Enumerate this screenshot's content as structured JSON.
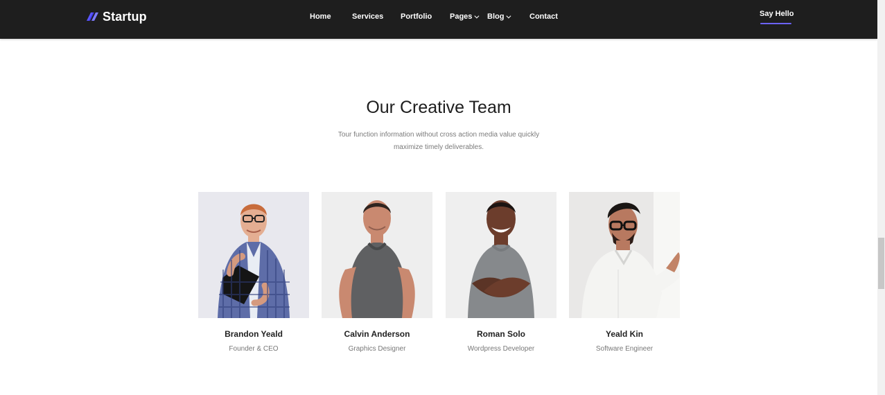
{
  "navbar": {
    "brand_name": "Startup",
    "brand_icon": "startup-logo-icon",
    "brand_accent": "#6c63ff",
    "items": [
      {
        "label": "Home",
        "has_dropdown": false
      },
      {
        "label": "Services",
        "has_dropdown": false
      },
      {
        "label": "Portfolio",
        "has_dropdown": false
      },
      {
        "label": "Pages",
        "has_dropdown": true,
        "dropdown_icon": "chevron-down-icon"
      },
      {
        "label": "Blog",
        "has_dropdown": true,
        "dropdown_icon": "chevron-down-icon"
      },
      {
        "label": "Contact",
        "has_dropdown": false
      }
    ],
    "cta_label": "Say Hello"
  },
  "team_section": {
    "title": "Our Creative Team",
    "subtitle": "Tour function information without cross action media value quickly maximize timely deliverables.",
    "members": [
      {
        "name": "Brandon Yeald",
        "role": "Founder & CEO",
        "photo_description": "man with glasses in plaid shirt holding tablet"
      },
      {
        "name": "Calvin Anderson",
        "role": "Graphics Designer",
        "photo_description": "man in dark gray t-shirt"
      },
      {
        "name": "Roman Solo",
        "role": "Wordpress Developer",
        "photo_description": "smiling man in gray t-shirt with crossed arms"
      },
      {
        "name": "Yeald Kin",
        "role": "Software Engineer",
        "photo_description": "man with glasses in white shirt pointing"
      }
    ]
  },
  "scrollbar": {
    "visible": true,
    "position_percent": 60
  },
  "colors": {
    "navbar_background": "#1e1e1e",
    "accent": "#6c63ff",
    "page_background": "#ffffff",
    "text_primary": "#1d1d1d",
    "text_secondary": "#777777"
  }
}
